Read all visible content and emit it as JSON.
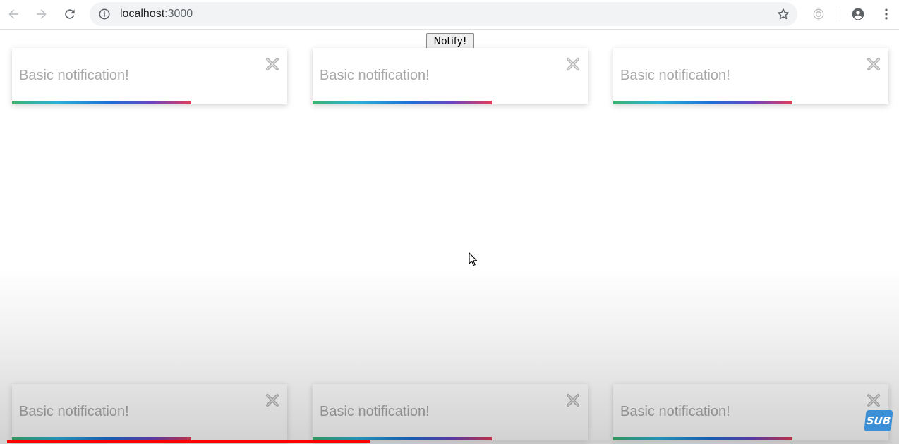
{
  "browser": {
    "url_host": "localhost",
    "url_port": ":3000"
  },
  "notify_button": {
    "label": "Notify!"
  },
  "notifications": {
    "top": [
      {
        "message": "Basic notification!",
        "progress": 0.65
      },
      {
        "message": "Basic notification!",
        "progress": 0.65
      },
      {
        "message": "Basic notification!",
        "progress": 0.65
      }
    ],
    "bottom": [
      {
        "message": "Basic notification!",
        "progress": 0.65
      },
      {
        "message": "Basic notification!",
        "progress": 0.65
      },
      {
        "message": "Basic notification!",
        "progress": 0.65
      }
    ]
  },
  "video": {
    "progress": 0.41
  },
  "badge": {
    "label": "SUB"
  },
  "colors": {
    "bar_start": "#3cb371",
    "bar_mid": "#1e6fd6",
    "bar_end": "#e23c5a",
    "video_progress": "#ff0000",
    "badge": "#3a8fd6"
  }
}
